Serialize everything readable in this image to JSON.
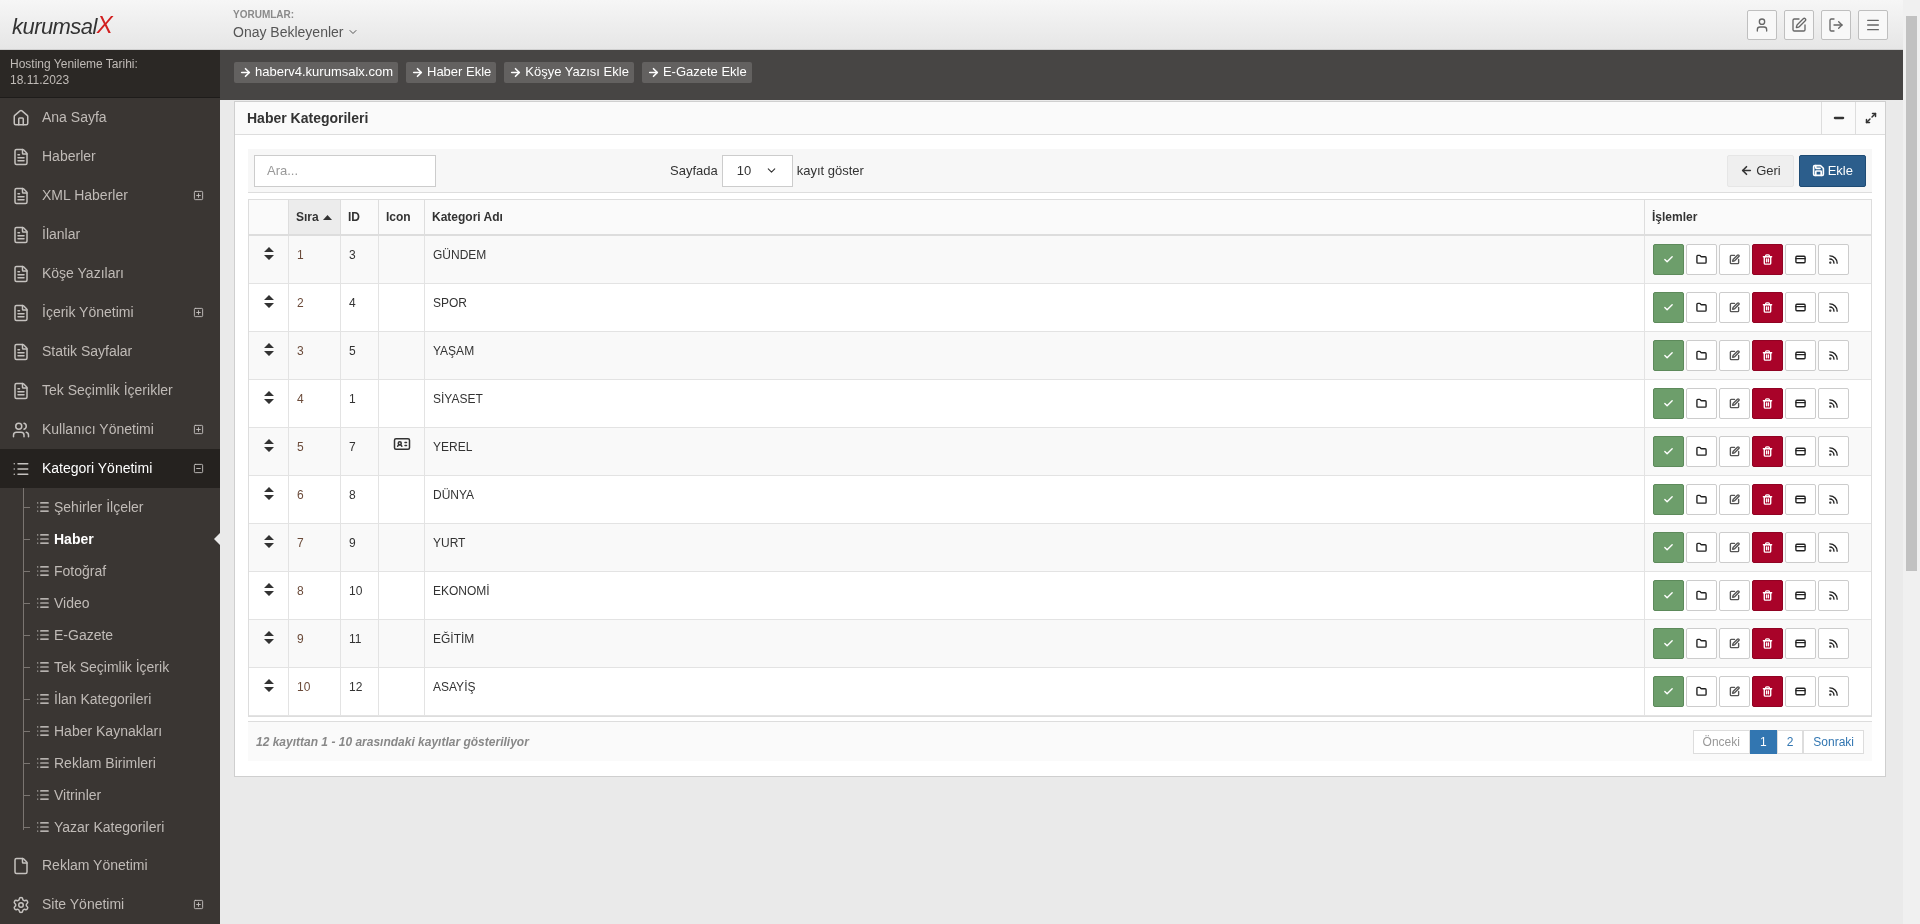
{
  "logo": {
    "text": "kurumsal",
    "mark": "X"
  },
  "header": {
    "section_label": "YORUMLAR:",
    "dropdown": "Onay Bekleyenler"
  },
  "hosting": {
    "label": "Hosting Yenileme Tarihi:",
    "date": "18.11.2023"
  },
  "quick_links": [
    "haberv4.kurumsalx.com",
    "Haber Ekle",
    "Köşye Yazısı Ekle",
    "E-Gazete Ekle"
  ],
  "sidebar": {
    "items": [
      {
        "label": "Ana Sayfa",
        "selected": false
      },
      {
        "label": "Haberler",
        "selected": false
      },
      {
        "label": "XML Haberler",
        "selected": false,
        "expanded": false
      },
      {
        "label": "İlanlar",
        "selected": false
      },
      {
        "label": "Köşe Yazıları",
        "selected": false
      },
      {
        "label": "İçerik Yönetimi",
        "selected": false,
        "expanded": false
      },
      {
        "label": "Statik Sayfalar",
        "selected": false
      },
      {
        "label": "Tek Seçimlik İçerikler",
        "selected": false
      },
      {
        "label": "Kullanıcı Yönetimi",
        "selected": false,
        "expanded": false
      },
      {
        "label": "Kategori Yönetimi",
        "selected": true,
        "expanded": true,
        "children": [
          {
            "label": "Şehirler İlçeler",
            "selected": false
          },
          {
            "label": "Haber",
            "selected": true
          },
          {
            "label": "Fotoğraf",
            "selected": false
          },
          {
            "label": "Video",
            "selected": false
          },
          {
            "label": "E-Gazete",
            "selected": false
          },
          {
            "label": "Tek Seçimlik İçerik",
            "selected": false
          },
          {
            "label": "İlan Kategorileri",
            "selected": false
          },
          {
            "label": "Haber Kaynakları",
            "selected": false
          },
          {
            "label": "Reklam Birimleri",
            "selected": false
          },
          {
            "label": "Vitrinler",
            "selected": false
          },
          {
            "label": "Yazar Kategorileri",
            "selected": false
          }
        ]
      },
      {
        "label": "Reklam Yönetimi",
        "selected": false
      },
      {
        "label": "Site Yönetimi",
        "selected": false,
        "expanded": false
      }
    ]
  },
  "panel": {
    "title": "Haber Kategorileri",
    "search": {
      "placeholder": "Ara..."
    },
    "page_size": {
      "prefix": "Sayfada",
      "value": "10",
      "suffix": "kayıt göster"
    },
    "buttons": [
      {
        "label": "Geri",
        "kind": "back"
      },
      {
        "label": "Ekle",
        "kind": "save"
      }
    ],
    "table": {
      "columns": [
        {
          "label": "Sıra",
          "sorted": true
        },
        {
          "label": "ID",
          "sorted": false
        },
        {
          "label": "Icon",
          "sorted": false
        },
        {
          "label": "Kategori Adı",
          "sorted": false
        },
        {
          "label": "İşlemler",
          "sorted": false
        }
      ],
      "rows": [
        {
          "order": "1",
          "id": "3",
          "has_icon": false,
          "name": "GÜNDEM"
        },
        {
          "order": "2",
          "id": "4",
          "has_icon": false,
          "name": "SPOR"
        },
        {
          "order": "3",
          "id": "5",
          "has_icon": false,
          "name": "YAŞAM"
        },
        {
          "order": "4",
          "id": "1",
          "has_icon": false,
          "name": "SİYASET"
        },
        {
          "order": "5",
          "id": "7",
          "has_icon": true,
          "name": "YEREL"
        },
        {
          "order": "6",
          "id": "8",
          "has_icon": false,
          "name": "DÜNYA"
        },
        {
          "order": "7",
          "id": "9",
          "has_icon": false,
          "name": "YURT"
        },
        {
          "order": "8",
          "id": "10",
          "has_icon": false,
          "name": "EKONOMİ"
        },
        {
          "order": "9",
          "id": "11",
          "has_icon": false,
          "name": "EĞİTİM"
        },
        {
          "order": "10",
          "id": "12",
          "has_icon": false,
          "name": "ASAYİŞ"
        }
      ]
    },
    "info": "12 kayıttan 1 - 10 arasındaki kayıtlar gösteriliyor",
    "pagination": [
      {
        "label": "Önceki",
        "selected": false,
        "disabled": true
      },
      {
        "label": "1",
        "selected": true,
        "disabled": false
      },
      {
        "label": "2",
        "selected": false,
        "disabled": false
      },
      {
        "label": "Sonraki",
        "selected": false,
        "disabled": false
      }
    ]
  }
}
